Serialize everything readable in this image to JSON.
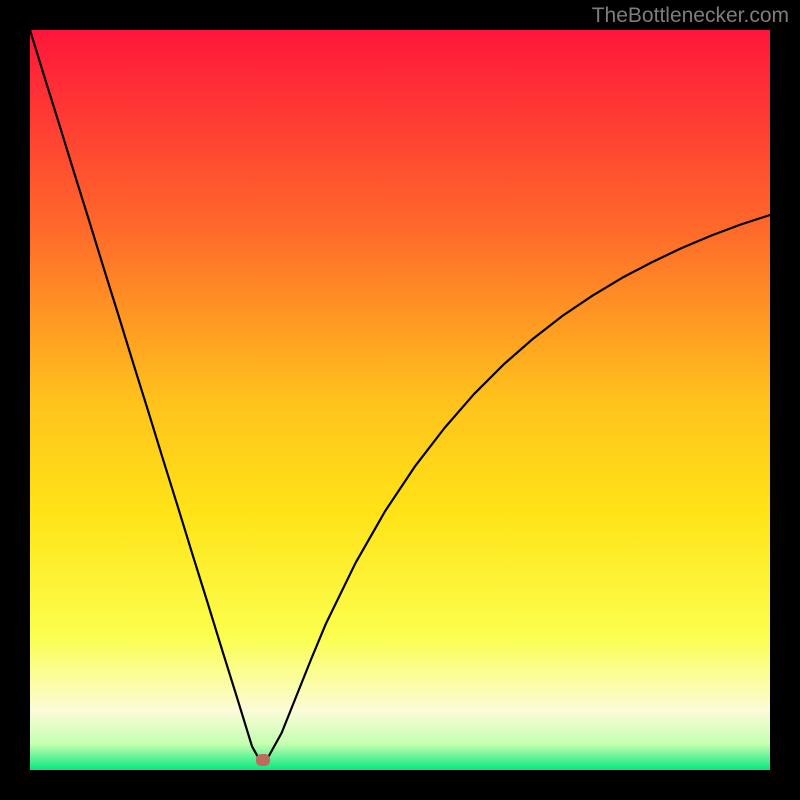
{
  "attribution": "TheBottlenecker.com",
  "colors": {
    "top": "#ff163b",
    "upper_mid": "#ff9a1f",
    "mid": "#ffe317",
    "lower_mid": "#faff47",
    "cream": "#fbfcd8",
    "bottom": "#06e880",
    "curve": "#000000",
    "marker": "#c06a5d",
    "frame": "#000000",
    "attribution_text": "#7d7d7d"
  },
  "chart_data": {
    "type": "line",
    "title": "",
    "xlabel": "",
    "ylabel": "",
    "xlim": [
      0,
      100
    ],
    "ylim": [
      0,
      100
    ],
    "grid": false,
    "legend": false,
    "series": [
      {
        "name": "bottleneck-curve",
        "x": [
          0,
          2,
          4,
          6,
          8,
          10,
          12,
          14,
          16,
          18,
          20,
          22,
          24,
          26,
          28,
          30,
          31,
          32,
          34,
          36,
          38,
          40,
          44,
          48,
          52,
          56,
          60,
          64,
          68,
          72,
          76,
          80,
          84,
          88,
          92,
          96,
          100
        ],
        "y": [
          100,
          93.5,
          87.1,
          80.6,
          74.2,
          67.7,
          61.3,
          54.8,
          48.4,
          41.9,
          35.5,
          29.0,
          22.6,
          16.1,
          9.7,
          3.2,
          1.4,
          1.4,
          5.0,
          10.0,
          15.0,
          19.8,
          28.0,
          35.0,
          41.0,
          46.2,
          50.8,
          54.8,
          58.3,
          61.4,
          64.1,
          66.5,
          68.6,
          70.5,
          72.2,
          73.7,
          75.0
        ]
      }
    ],
    "marker": {
      "x": 31.5,
      "y": 1.4
    },
    "background_gradient_stops": [
      {
        "pos": 0.0,
        "color": "#ff163b"
      },
      {
        "pos": 0.27,
        "color": "#ff6a2a"
      },
      {
        "pos": 0.5,
        "color": "#ffc21c"
      },
      {
        "pos": 0.65,
        "color": "#ffe317"
      },
      {
        "pos": 0.82,
        "color": "#fbff4e"
      },
      {
        "pos": 0.92,
        "color": "#fbfcd8"
      },
      {
        "pos": 0.965,
        "color": "#c4ffb0"
      },
      {
        "pos": 1.0,
        "color": "#06e880"
      }
    ]
  }
}
